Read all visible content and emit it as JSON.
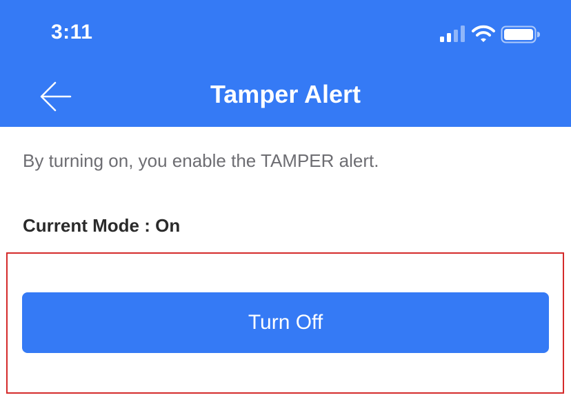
{
  "status_bar": {
    "time": "3:11",
    "icons": [
      "cellular-signal-icon",
      "wifi-icon",
      "battery-icon"
    ]
  },
  "header": {
    "title": "Tamper Alert",
    "back_icon": "arrow-left-icon",
    "background_color": "#357af5"
  },
  "content": {
    "description": "By turning on, you enable the TAMPER alert.",
    "current_mode": "Current Mode : On"
  },
  "action": {
    "button_label": "Turn Off",
    "button_color": "#357af5"
  },
  "highlight": {
    "border_color": "#d42a2a"
  }
}
